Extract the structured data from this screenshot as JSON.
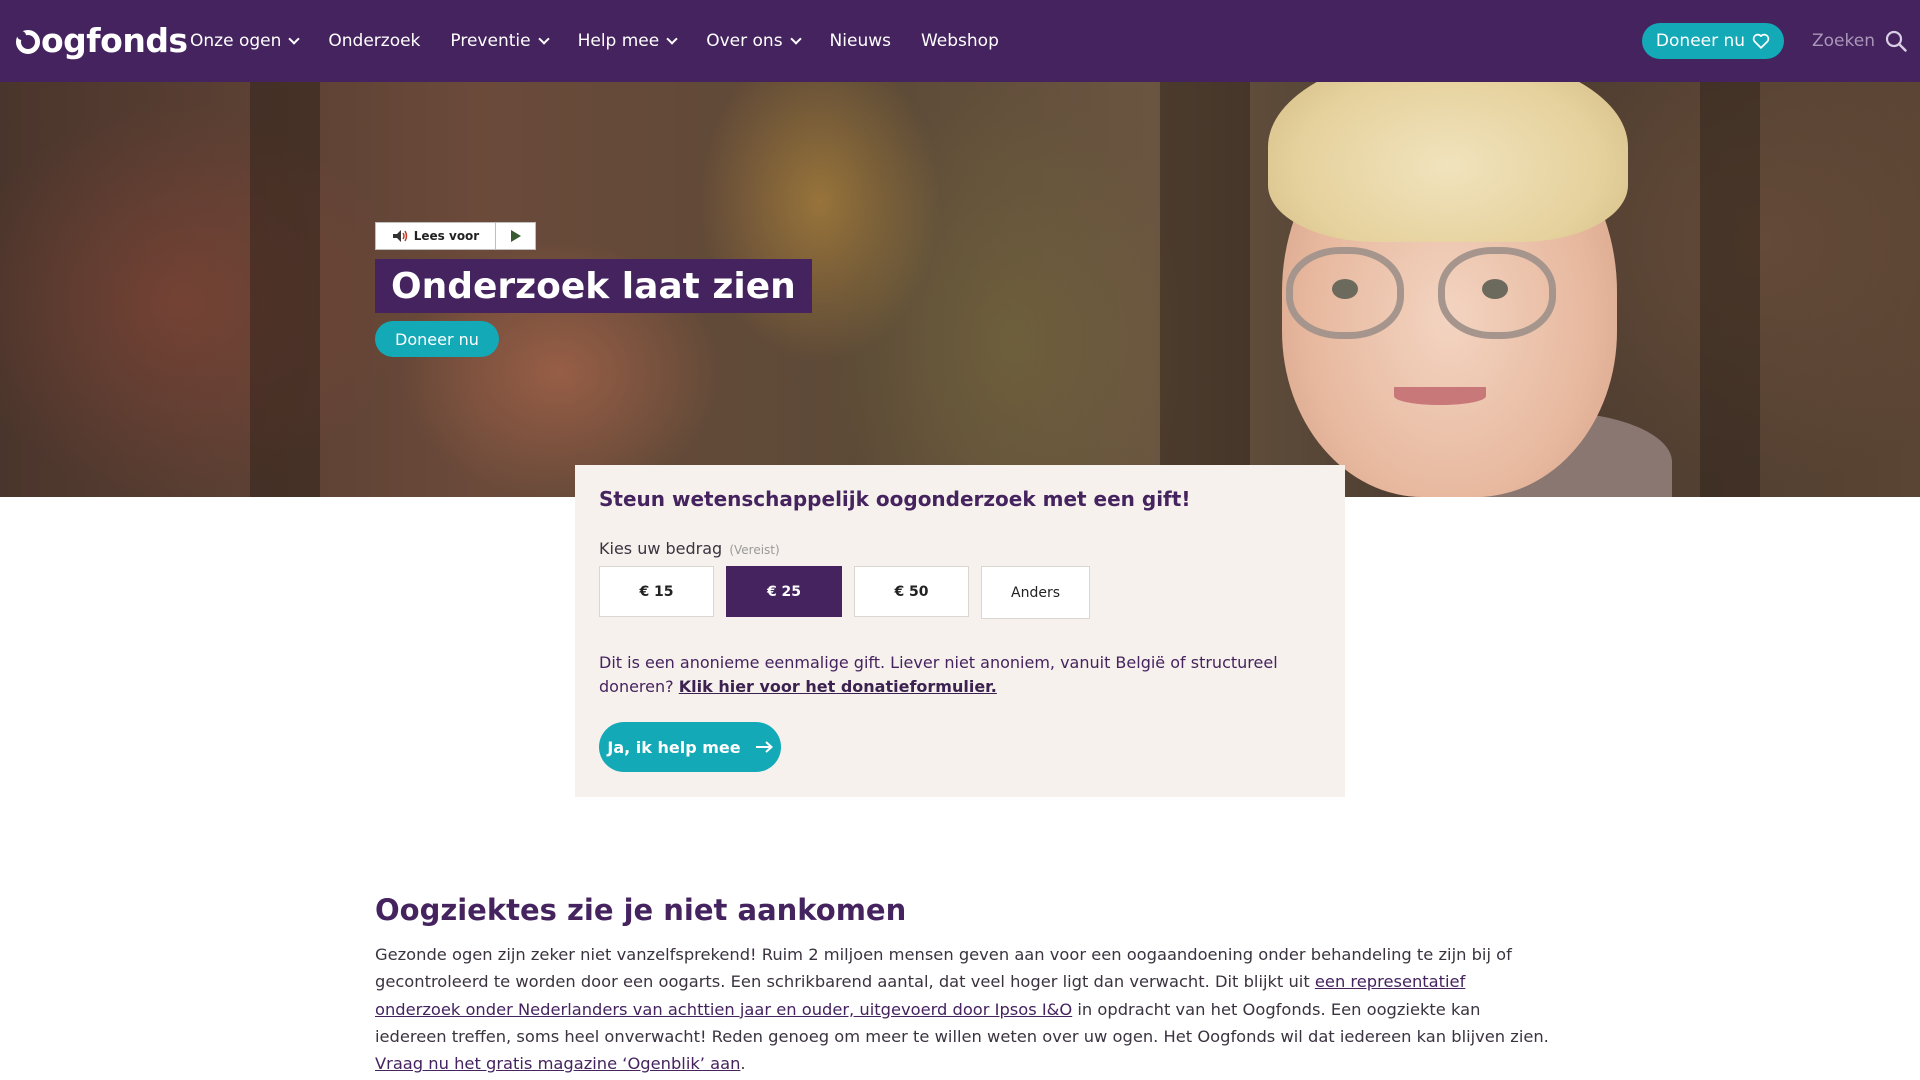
{
  "brand": {
    "logo_text": "ogfonds",
    "primary": "#45235f",
    "accent": "#13a9b6"
  },
  "nav": {
    "items": [
      {
        "label": "Onze ogen",
        "dropdown": true
      },
      {
        "label": "Onderzoek",
        "dropdown": false
      },
      {
        "label": "Preventie",
        "dropdown": true
      },
      {
        "label": "Help mee",
        "dropdown": true
      },
      {
        "label": "Over ons",
        "dropdown": true
      },
      {
        "label": "Nieuws",
        "dropdown": false
      },
      {
        "label": "Webshop",
        "dropdown": false
      }
    ],
    "donate_label": "Doneer nu",
    "search_label": "Zoeken"
  },
  "hero": {
    "readspeaker_label": "Lees voor",
    "title": "Onderzoek laat zien",
    "donate_label": "Doneer nu"
  },
  "donation": {
    "heading": "Steun wetenschappelijk oogonderzoek met een gift!",
    "amount_label": "Kies uw bedrag",
    "required_label": "(Vereist)",
    "amounts": [
      {
        "label": "€ 15",
        "selected": false
      },
      {
        "label": "€ 25",
        "selected": true
      },
      {
        "label": "€ 50",
        "selected": false
      },
      {
        "label": "Anders",
        "selected": false
      }
    ],
    "note_text": "Dit is een anonieme eenmalige gift. Liever niet anoniem, vanuit België of structureel doneren?",
    "note_link": "Klik hier voor het donatieformulier.",
    "submit_label": "Ja, ik help mee"
  },
  "content": {
    "title": "Oogziektes zie je niet aankomen",
    "p1": "Gezonde ogen zijn zeker niet vanzelfsprekend! Ruim 2 miljoen mensen geven aan voor een oogaandoening onder behandeling te zijn bij of gecontroleerd te worden door een oogarts. Een schrikbarend aantal, dat veel hoger ligt dan verwacht. Dit blijkt uit",
    "link1": "een representatief onderzoek onder Nederlanders van achttien jaar en ouder, uitgevoerd door Ipsos I&O",
    "p2": "in opdracht van het Oogfonds. Een oogziekte kan iedereen treffen, soms heel onverwacht! Reden genoeg om meer te willen weten over uw ogen. Het Oogfonds wil dat iedereen kan blijven zien.",
    "link2": "Vraag nu het gratis magazine ‘Ogenblik’ aan",
    "p3_end": "."
  }
}
